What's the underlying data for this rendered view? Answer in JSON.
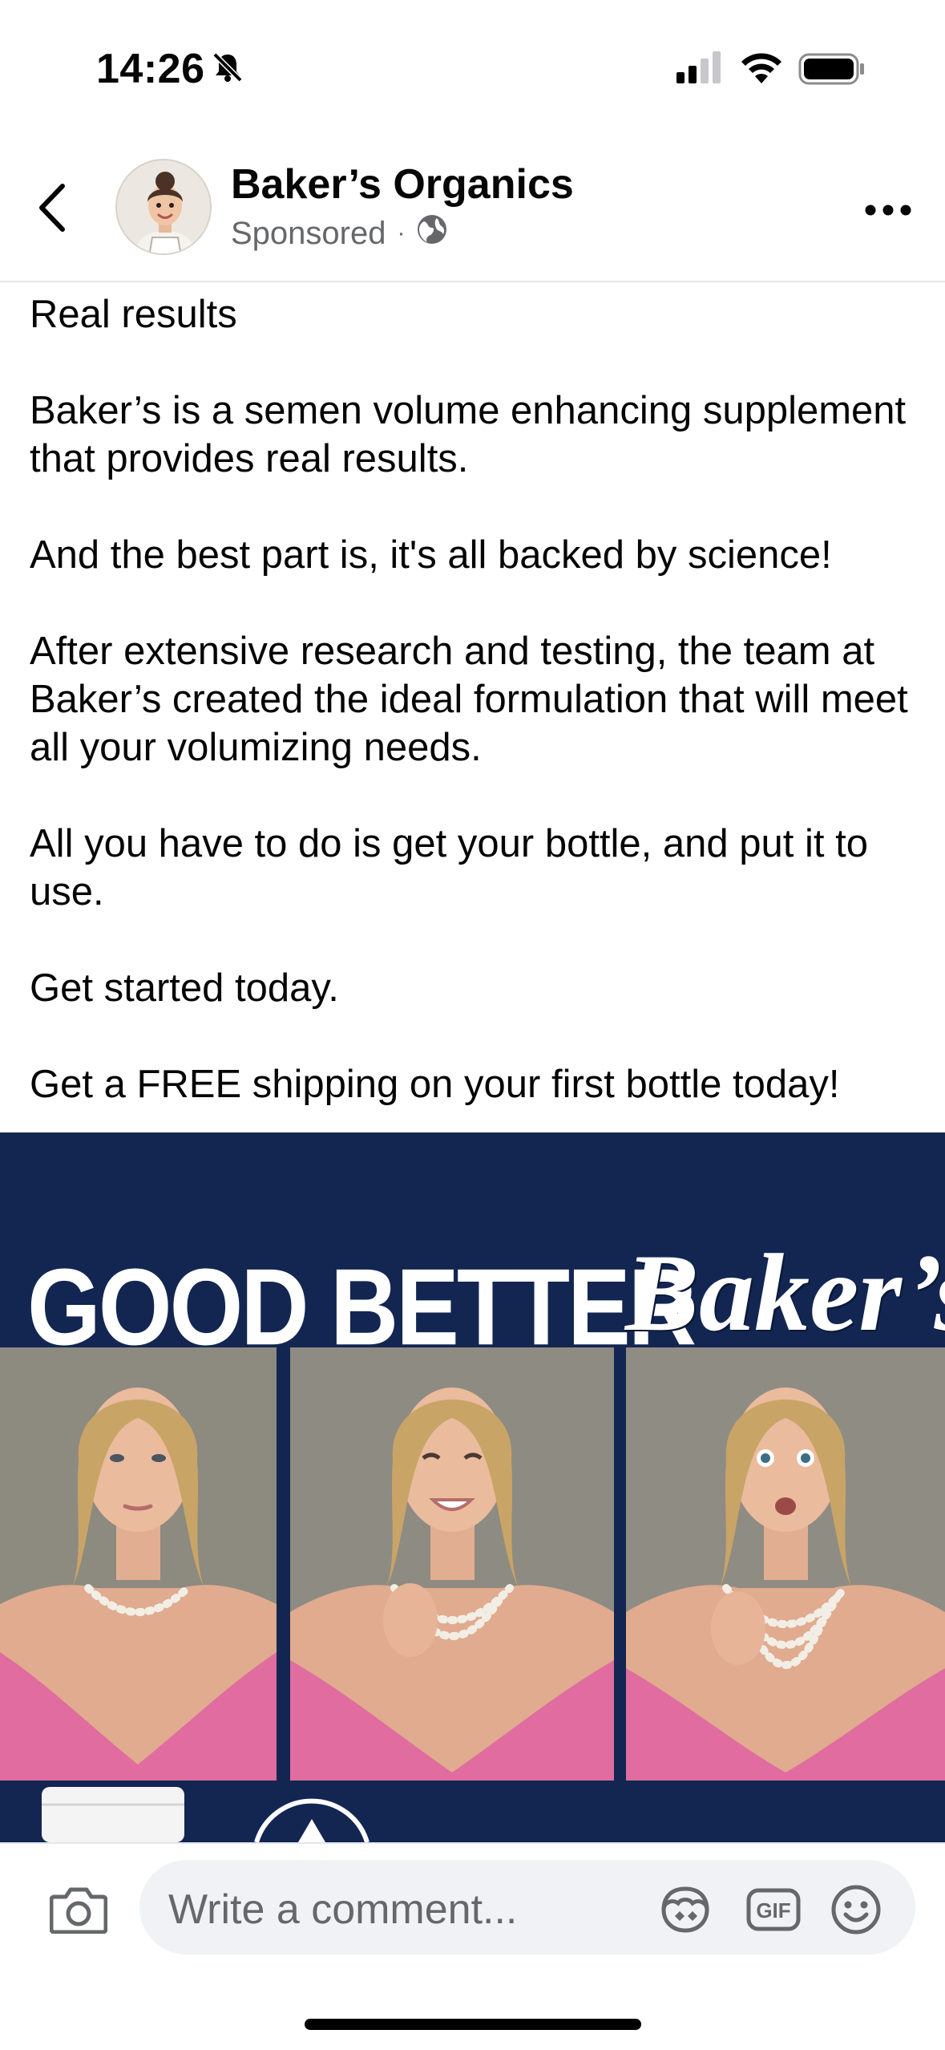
{
  "status_bar": {
    "time": "14:26",
    "icons": [
      "bell-slash-icon",
      "signal-icon",
      "wifi-icon",
      "battery-icon"
    ]
  },
  "header": {
    "page_name": "Baker’s Organics",
    "sponsored": "Sponsored",
    "separator": "·",
    "icons": [
      "back-icon",
      "globe-icon",
      "more-icon"
    ]
  },
  "post": {
    "paragraphs": [
      "Real results",
      "Baker’s is a semen volume enhancing supplement that provides real results.",
      "And the best part is, it's all backed by science!",
      "After extensive research and testing, the team at Baker’s created the ideal formulation that will meet all your volumizing needs.",
      "All you have to do is get your bottle, and put it to use.",
      "Get started today.",
      "Get a FREE shipping on your first bottle today!"
    ]
  },
  "ad_image": {
    "labels": [
      "GOOD",
      "BETTER",
      "Baker’s"
    ],
    "background_color": "#132652"
  },
  "comment_bar": {
    "placeholder": "Write a comment...",
    "gif_label": "GIF",
    "icons": [
      "camera-icon",
      "avatar-sticker-icon",
      "gif-icon",
      "emoji-icon"
    ]
  },
  "colors": {
    "text_primary": "#050505",
    "text_secondary": "#65676b",
    "input_bg": "#f0f2f5",
    "divider": "#e4e6eb"
  }
}
